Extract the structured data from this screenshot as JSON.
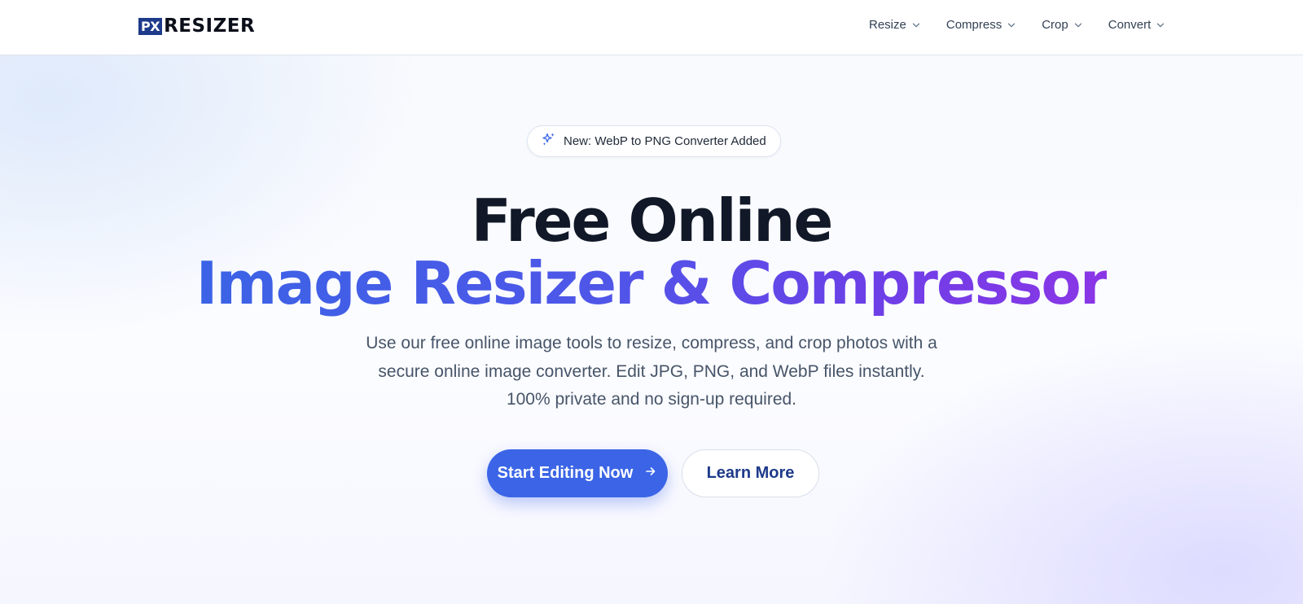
{
  "header": {
    "logo": {
      "mark": "PX",
      "text": "RESIZER"
    },
    "nav": [
      {
        "label": "Resize",
        "icon": "chevron-down-icon"
      },
      {
        "label": "Compress",
        "icon": "chevron-down-icon"
      },
      {
        "label": "Crop",
        "icon": "chevron-down-icon"
      },
      {
        "label": "Convert",
        "icon": "chevron-down-icon"
      }
    ]
  },
  "hero": {
    "badge": {
      "icon": "sparkles-icon",
      "text": "New: WebP to PNG Converter Added"
    },
    "headline_line1": "Free Online",
    "headline_line2": "Image Resizer & Compressor",
    "subtitle_lines": [
      "Use our free online image tools to resize, compress, and crop photos with a",
      "secure online image converter. Edit JPG, PNG, and WebP files instantly.",
      "100% private and no sign-up required."
    ],
    "primary_button": {
      "label": "Start Editing Now",
      "icon": "arrow-right-icon"
    },
    "secondary_button": {
      "label": "Learn More"
    }
  },
  "colors": {
    "accent": "#3b65e6",
    "gradient_start": "#3b63e6",
    "gradient_end": "#8b36e6",
    "logo_mark": "#1e3a8a",
    "heading": "#111827"
  }
}
